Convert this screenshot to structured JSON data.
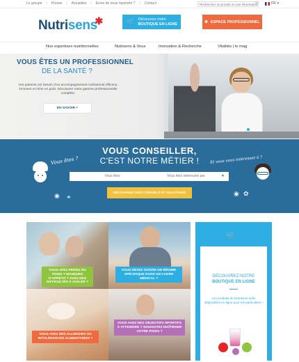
{
  "topbar": {
    "links": [
      "Le groupe",
      "Presse",
      "Actualités",
      "Envie de nous rejoindre ?",
      "Contact"
    ],
    "search_placeholder": "Rechercher un produit ou une information",
    "language": "FR"
  },
  "header": {
    "logo_part1": "Nutri",
    "logo_part2": "sens",
    "shop_button": {
      "line1": "Découvrez notre",
      "line2": "BOUTIQUE EN LIGNE"
    },
    "pro_button": "ESPACE PROFESSIONNEL"
  },
  "nav": {
    "items": [
      "Nos expertises nutritionnelles",
      "Nutrisens & Vous",
      "Innovation & Recherche",
      "Vitalités | le mag"
    ]
  },
  "hero": {
    "title": "VOUS ÊTES UN PROFESSIONNEL",
    "subtitle": "DE LA SANTÉ ?",
    "text": "Vos patients ont besoin d'un accompagnement nutritionnel efficace, innovant et riche en goût. Découvrez notre gamme professionnelle complète.",
    "cta": "EN SAVOIR +",
    "slides": 4,
    "active_slide": 3
  },
  "advice": {
    "heading1": "VOUS CONSEILLER,",
    "heading2": "C'EST NOTRE MÉTIER !",
    "left_hand_label": "Vous êtes ?",
    "right_hand_label": "Et vous vous intéressez à ?",
    "select1": "Vous êtes",
    "select2": "Vous êtes intéressés par",
    "button": "DÉCOUVREZ NOS CONSEILS ET SOLUTIONS"
  },
  "tiles": [
    {
      "label": "VOUS AVEZ PERDU DU POIDS ? MANQUEZ D'APPÉTIT ? AVEZ DES DIFFICULTÉS À AVALER ?",
      "color": "#8fc43e"
    },
    {
      "label": "VOUS DEVEZ SUIVRE UN RÉGIME SPÉCIFIQUE DANS UN CADRE MÉDICAL ?",
      "color": "#2dafe3"
    },
    {
      "label": "VOUS AVEZ DES ALLERGIES OU INTOLÉRANCES ALIMENTAIRES ?",
      "color": "#f06a3f"
    },
    {
      "label": "VOUS AVEZ DES OBJECTIFS SPORTIFS À ATTEINDRE ? SOUHAITEZ MAÎTRISER VOTRE POIDS ?",
      "color": "#b46fb8"
    }
  ],
  "promo": {
    "title_line1": "DÉCOUVREZ NOTRE",
    "title_line2": "BOUTIQUE EN LIGNE",
    "body": "Les produits de Nutrisens enfin disponibles en ligne pour les particuliers !"
  },
  "colors": {
    "brand_dark": "#1f4f78",
    "brand_light": "#2dafe3",
    "accent_orange": "#f06a3f",
    "accent_red": "#e52629",
    "band_blue": "#2b6d9a",
    "button_yellow": "#f3c13c"
  }
}
